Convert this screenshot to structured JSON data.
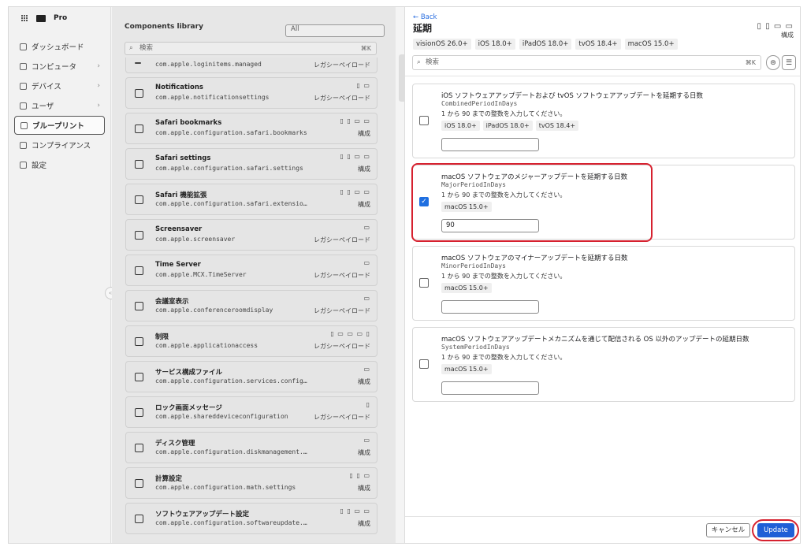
{
  "app": {
    "name": "Pro"
  },
  "sidebar": {
    "items": [
      {
        "label": "ダッシュボード",
        "chevron": false,
        "active": false
      },
      {
        "label": "コンピュータ",
        "chevron": true,
        "active": false
      },
      {
        "label": "デバイス",
        "chevron": true,
        "active": false
      },
      {
        "label": "ユーザ",
        "chevron": true,
        "active": false
      },
      {
        "label": "ブループリント",
        "chevron": false,
        "active": true
      },
      {
        "label": "コンプライアンス",
        "chevron": false,
        "active": false
      },
      {
        "label": "設定",
        "chevron": false,
        "active": false
      }
    ]
  },
  "library": {
    "title": "Components library",
    "filter": "All",
    "search_placeholder": "検索",
    "search_shortcut": "⌘K",
    "cards": [
      {
        "title": "",
        "subtitle": "com.apple.loginitems.managed",
        "devices": "",
        "right": "レガシーペイロード"
      },
      {
        "title": "Notifications",
        "subtitle": "com.apple.notificationsettings",
        "devices": "▯ ▭",
        "right": "レガシーペイロード"
      },
      {
        "title": "Safari bookmarks",
        "subtitle": "com.apple.configuration.safari.bookmarks",
        "devices": "▯ ▯ ▭ ▭",
        "right": "構成"
      },
      {
        "title": "Safari settings",
        "subtitle": "com.apple.configuration.safari.settings",
        "devices": "▯ ▯ ▭ ▭",
        "right": "構成"
      },
      {
        "title": "Safari 機能拡張",
        "subtitle": "com.apple.configuration.safari.extensions",
        "devices": "▯ ▯ ▭ ▭",
        "right": "構成"
      },
      {
        "title": "Screensaver",
        "subtitle": "com.apple.screensaver",
        "devices": "▭",
        "right": "レガシーペイロード"
      },
      {
        "title": "Time Server",
        "subtitle": "com.apple.MCX.TimeServer",
        "devices": "▭",
        "right": "レガシーペイロード"
      },
      {
        "title": "会議室表示",
        "subtitle": "com.apple.conferenceroomdisplay",
        "devices": "▭",
        "right": "レガシーペイロード"
      },
      {
        "title": "制限",
        "subtitle": "com.apple.applicationaccess",
        "devices": "▯ ▭ ▭ ▭ ▯",
        "right": "レガシーペイロード"
      },
      {
        "title": "サービス構成ファイル",
        "subtitle": "com.apple.configuration.services.configuration-files",
        "devices": "▭",
        "right": "構成"
      },
      {
        "title": "ロック画面メッセージ",
        "subtitle": "com.apple.shareddeviceconfiguration",
        "devices": "▯",
        "right": "レガシーペイロード"
      },
      {
        "title": "ディスク管理",
        "subtitle": "com.apple.configuration.diskmanagement.settings",
        "devices": "▭",
        "right": "構成"
      },
      {
        "title": "計算設定",
        "subtitle": "com.apple.configuration.math.settings",
        "devices": "▯ ▯ ▭",
        "right": "構成"
      },
      {
        "title": "ソフトウェアアップデート設定",
        "subtitle": "com.apple.configuration.softwareupdate.settings",
        "devices": "▯ ▯ ▭ ▭",
        "right": "構成"
      }
    ]
  },
  "panel": {
    "back": "← Back",
    "title": "延期",
    "devices": "▯ ▯ ▭ ▭",
    "type": "構成",
    "os_tags": [
      "visionOS 26.0+",
      "iOS 18.0+",
      "iPadOS 18.0+",
      "tvOS 18.4+",
      "macOS 15.0+"
    ],
    "search_placeholder": "検索",
    "search_shortcut": "⌘K",
    "filter_icon": "⊜",
    "adjust_icon": "☰",
    "settings": [
      {
        "title": "iOS ソフトウェアアップデートおよび tvOS ソフトウェアアップデートを延期する日数",
        "key": "CombinedPeriodInDays",
        "description": "1 から 90 までの整数を入力してください。",
        "tags": [
          "iOS 18.0+",
          "iPadOS 18.0+",
          "tvOS 18.4+"
        ],
        "checked": false,
        "value": ""
      },
      {
        "title": "macOS ソフトウェアのメジャーアップデートを延期する日数",
        "key": "MajorPeriodInDays",
        "description": "1 から 90 までの整数を入力してください。",
        "tags": [
          "macOS 15.0+"
        ],
        "checked": true,
        "value": "90"
      },
      {
        "title": "macOS ソフトウェアのマイナーアップデートを延期する日数",
        "key": "MinorPeriodInDays",
        "description": "1 から 90 までの整数を入力してください。",
        "tags": [
          "macOS 15.0+"
        ],
        "checked": false,
        "value": ""
      },
      {
        "title": "macOS ソフトウェアアップデートメカニズムを通じて配信される OS 以外のアップデートの延期日数",
        "key": "SystemPeriodInDays",
        "description": "1 から 90 までの整数を入力してください。",
        "tags": [
          "macOS 15.0+"
        ],
        "checked": false,
        "value": ""
      }
    ],
    "cancel_label": "キャンセル",
    "update_label": "Update"
  },
  "colors": {
    "accent": "#1f5fd6",
    "highlight": "#d6212f"
  }
}
